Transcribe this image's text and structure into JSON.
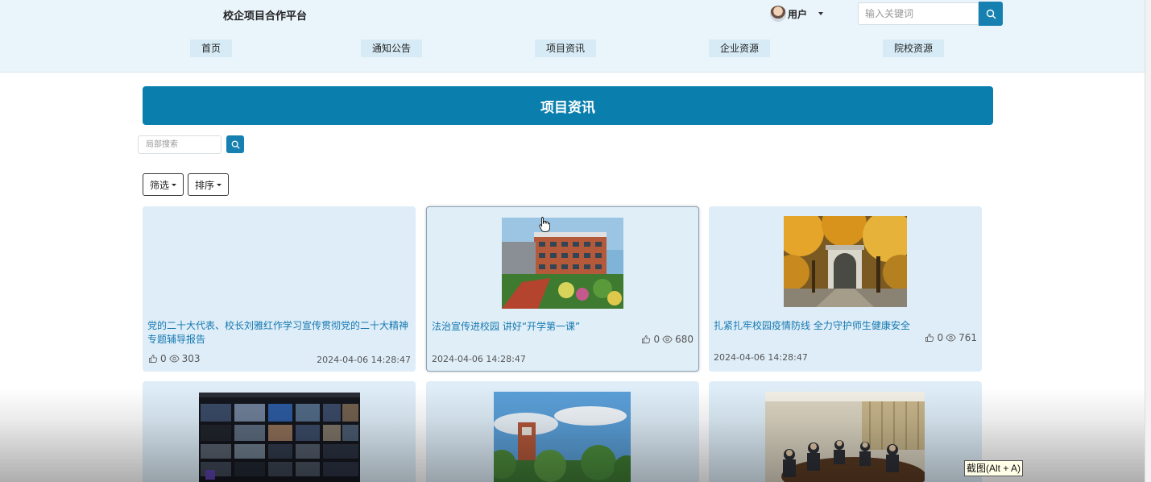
{
  "header": {
    "site_title": "校企项目合作平台",
    "user_label": "用户",
    "search_placeholder": "输入关键词"
  },
  "nav": {
    "items": [
      {
        "label": "首页"
      },
      {
        "label": "通知公告"
      },
      {
        "label": "项目资讯"
      },
      {
        "label": "企业资源"
      },
      {
        "label": "院校资源"
      }
    ]
  },
  "banner": {
    "title": "项目资讯"
  },
  "local_search": {
    "placeholder": "局部搜索"
  },
  "toolbar": {
    "filter_label": "筛选",
    "sort_label": "排序"
  },
  "cards": [
    {
      "title": "党的二十大代表、校长刘雅红作学习宣传贯彻党的二十大精神专题辅导报告",
      "likes": "0",
      "views": "303",
      "date": "2024-04-06 14:28:47"
    },
    {
      "title": "法治宣传进校园 讲好“开学第一课”",
      "likes": "0",
      "views": "680",
      "date": "2024-04-06 14:28:47"
    },
    {
      "title": "扎紧扎牢校园疫情防线 全力守护师生健康安全",
      "likes": "0",
      "views": "761",
      "date": "2024-04-06 14:28:47"
    }
  ],
  "overlay": {
    "screenshot_tip": "截图(Alt + A)"
  },
  "colors": {
    "header_bg": "#eaf4fb",
    "nav_bg": "#d7ebf6",
    "accent": "#0a7fad",
    "card_bg": "#deedf8",
    "title_link": "#1579b0"
  },
  "icons": [
    "search-icon",
    "thumb-up-icon",
    "eye-icon",
    "chevron-down-icon",
    "hand-cursor-icon"
  ]
}
